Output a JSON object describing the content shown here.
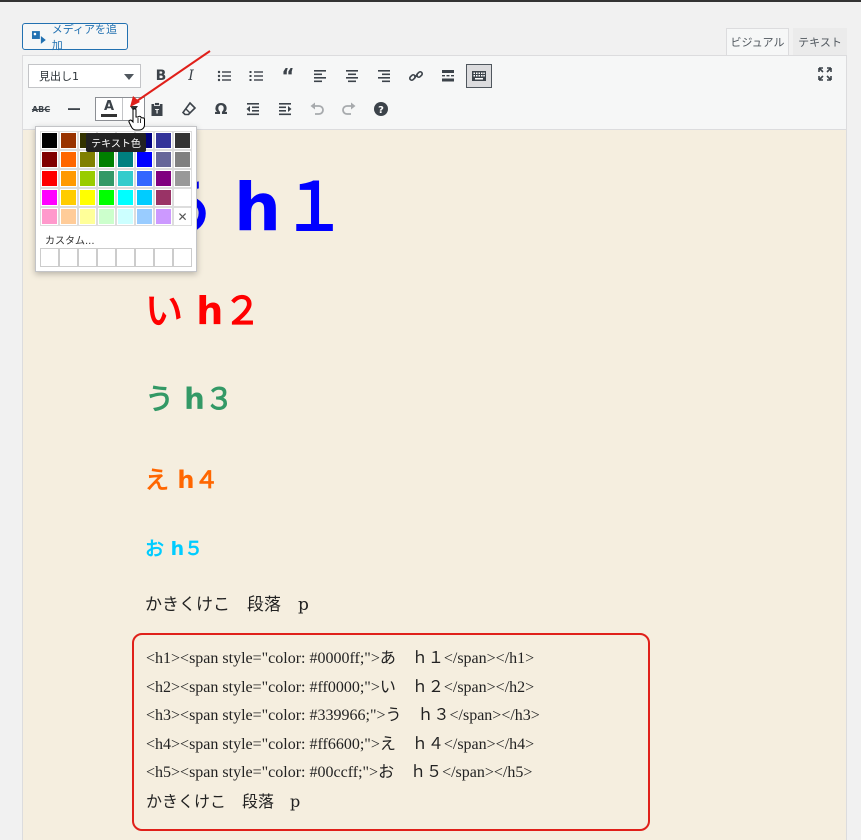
{
  "media_button": {
    "label": "メディアを追加"
  },
  "tabs": [
    {
      "label": "ビジュアル"
    },
    {
      "label": "テキスト"
    }
  ],
  "toolbar": {
    "format_select": "見出し1",
    "tooltip": "テキスト色"
  },
  "color_picker": {
    "custom_label": "カスタム...",
    "swatches": [
      "#000000",
      "#993300",
      "#333300",
      "#003300",
      "#003366",
      "#000080",
      "#333399",
      "#333333",
      "#800000",
      "#ff6600",
      "#808000",
      "#008000",
      "#008080",
      "#0000ff",
      "#666699",
      "#808080",
      "#ff0000",
      "#ff9900",
      "#99cc00",
      "#339966",
      "#33cccc",
      "#3366ff",
      "#800080",
      "#999999",
      "#ff00ff",
      "#ffcc00",
      "#ffff00",
      "#00ff00",
      "#00ffff",
      "#00ccff",
      "#993366",
      "#ffffff",
      "#ff99cc",
      "#ffcc99",
      "#ffff99",
      "#ccffcc",
      "#ccffff",
      "#99ccff",
      "#cc99ff",
      "none"
    ]
  },
  "content": {
    "h1": "あ h１",
    "h2": "い h２",
    "h3": "う h３",
    "h4": "え h４",
    "h5": "お h５",
    "p": "かきくけこ　段落　p",
    "code_lines": [
      "<h1><span style=\"color: #0000ff;\">あ　ｈ１</span></h1>",
      "<h2><span style=\"color: #ff0000;\">い　ｈ２</span></h2>",
      "<h3><span style=\"color: #339966;\">う　ｈ３</span></h3>",
      "<h4><span style=\"color: #ff6600;\">え　ｈ４</span></h4>",
      "<h5><span style=\"color: #00ccff;\">お　ｈ５</span></h5>",
      "かきくけこ　段落　p"
    ]
  }
}
